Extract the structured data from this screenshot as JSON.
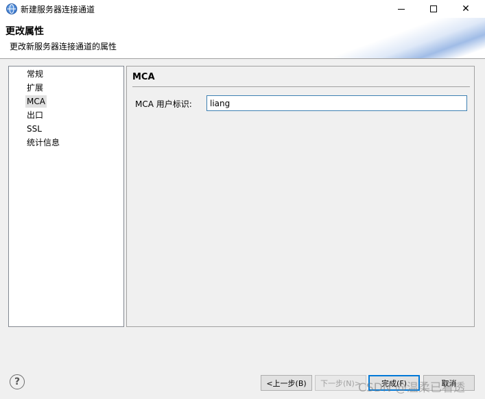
{
  "window": {
    "title": "新建服务器连接通道",
    "icon": "globe-icon"
  },
  "header": {
    "title": "更改属性",
    "subtitle": "更改新服务器连接通道的属性"
  },
  "nav": {
    "items": [
      {
        "label": "常规",
        "selected": false
      },
      {
        "label": "扩展",
        "selected": false
      },
      {
        "label": "MCA",
        "selected": true
      },
      {
        "label": "出口",
        "selected": false
      },
      {
        "label": "SSL",
        "selected": false
      },
      {
        "label": "统计信息",
        "selected": false
      }
    ]
  },
  "panel": {
    "title": "MCA",
    "field_label": "MCA 用户标识:",
    "field_value": "liang"
  },
  "footer": {
    "help_glyph": "?",
    "back_label": "<上一步(B)",
    "next_label": "下一步(N)>",
    "finish_label": "完成(F)",
    "cancel_label": "取消",
    "watermark": "CSDN @温柔已看透"
  },
  "colors": {
    "focus_border": "#0078d7",
    "input_border": "#3c7fb1",
    "selection": "#e0e0e0"
  }
}
